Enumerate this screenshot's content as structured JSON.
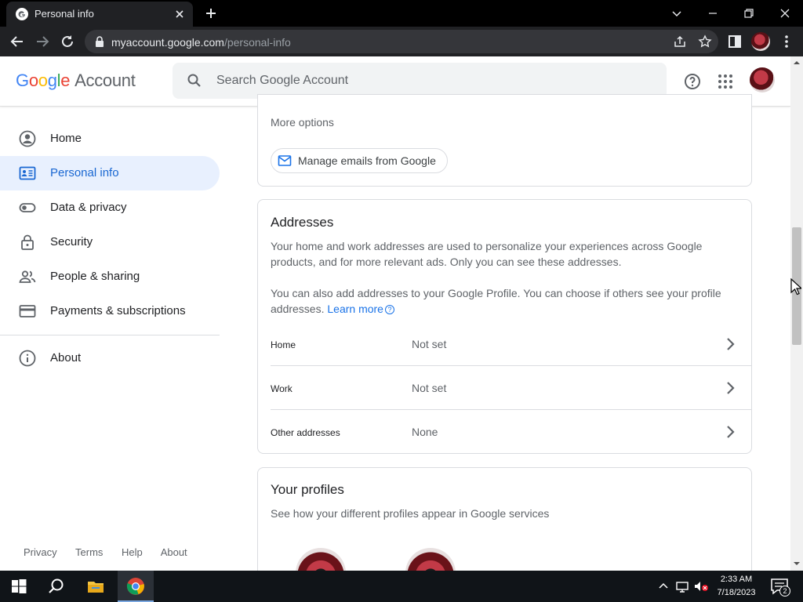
{
  "browser": {
    "tab_title": "Personal info",
    "url_domain": "myaccount.google.com",
    "url_path": "/personal-info"
  },
  "header": {
    "logo_letters": [
      "G",
      "o",
      "o",
      "g",
      "l",
      "e"
    ],
    "logo_colors": [
      "#4285F4",
      "#EA4335",
      "#FBBC05",
      "#4285F4",
      "#34A853",
      "#EA4335"
    ],
    "account_label": "Account",
    "search_placeholder": "Search Google Account"
  },
  "sidebar": {
    "items": [
      {
        "label": "Home",
        "icon": "account-circle-icon"
      },
      {
        "label": "Personal info",
        "icon": "id-card-icon",
        "active": true
      },
      {
        "label": "Data & privacy",
        "icon": "toggle-icon"
      },
      {
        "label": "Security",
        "icon": "lock-icon"
      },
      {
        "label": "People & sharing",
        "icon": "people-icon"
      },
      {
        "label": "Payments & subscriptions",
        "icon": "credit-card-icon"
      },
      {
        "label": "About",
        "icon": "info-icon"
      }
    ],
    "footer": [
      "Privacy",
      "Terms",
      "Help",
      "About"
    ]
  },
  "emails_card": {
    "more_options": "More options",
    "manage_button": "Manage emails from Google"
  },
  "addresses_card": {
    "title": "Addresses",
    "para1": "Your home and work addresses are used to personalize your experiences across Google products, and for more relevant ads. Only you can see these addresses.",
    "para2": "You can also add addresses to your Google Profile. You can choose if others see your profile addresses.",
    "learn_more": "Learn more",
    "rows": [
      {
        "label": "Home",
        "value": "Not set"
      },
      {
        "label": "Work",
        "value": "Not set"
      },
      {
        "label": "Other addresses",
        "value": "None"
      }
    ]
  },
  "profiles_card": {
    "title": "Your profiles",
    "subtitle": "See how your different profiles appear in Google services"
  },
  "taskbar": {
    "time": "2:33 AM",
    "date": "7/18/2023",
    "notification_count": "2"
  },
  "colors": {
    "accent": "#1a73e8",
    "active_nav_bg": "#e8f0fe"
  }
}
